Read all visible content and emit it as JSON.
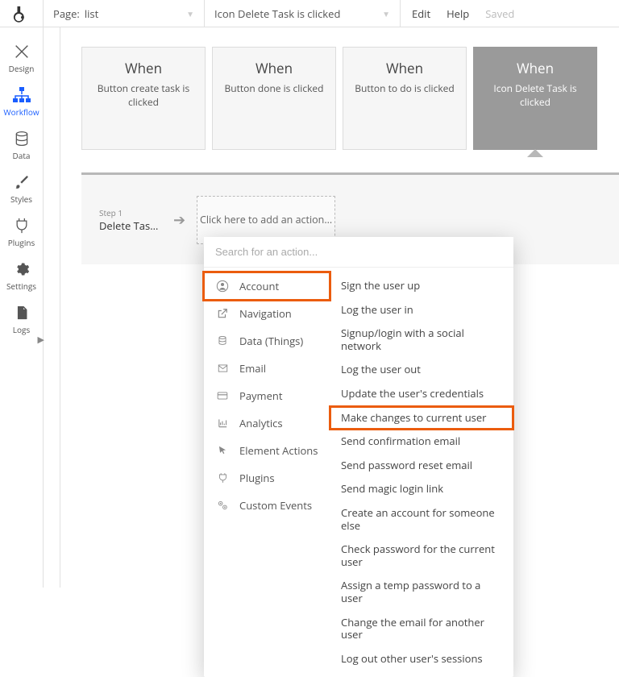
{
  "topbar": {
    "page_label": "Page:",
    "page_value": "list",
    "workflow_value": "Icon Delete Task is clicked",
    "menu_edit": "Edit",
    "menu_help": "Help",
    "menu_saved": "Saved"
  },
  "rail": {
    "design": "Design",
    "workflow": "Workflow",
    "data": "Data",
    "styles": "Styles",
    "plugins": "Plugins",
    "settings": "Settings",
    "logs": "Logs"
  },
  "events": [
    {
      "when": "When",
      "desc": "Button create task is clicked",
      "selected": false
    },
    {
      "when": "When",
      "desc": "Button done is clicked",
      "selected": false
    },
    {
      "when": "When",
      "desc": "Button to do is clicked",
      "selected": false
    },
    {
      "when": "When",
      "desc": "Icon Delete Task is clicked",
      "selected": true
    }
  ],
  "step": {
    "num": "Step 1",
    "label": "Delete Task...",
    "add_action": "Click here to add an action..."
  },
  "dropdown": {
    "search_placeholder": "Search for an action...",
    "categories": [
      {
        "label": "Account",
        "icon": "user-circle",
        "highlighted": true
      },
      {
        "label": "Navigation",
        "icon": "external",
        "highlighted": false
      },
      {
        "label": "Data (Things)",
        "icon": "database",
        "highlighted": false
      },
      {
        "label": "Email",
        "icon": "envelope",
        "highlighted": false
      },
      {
        "label": "Payment",
        "icon": "card",
        "highlighted": false
      },
      {
        "label": "Analytics",
        "icon": "chart",
        "highlighted": false
      },
      {
        "label": "Element Actions",
        "icon": "cursor",
        "highlighted": false
      },
      {
        "label": "Plugins",
        "icon": "plug",
        "highlighted": false
      },
      {
        "label": "Custom Events",
        "icon": "gears",
        "highlighted": false
      }
    ],
    "actions": [
      {
        "label": "Sign the user up",
        "highlighted": false
      },
      {
        "label": "Log the user in",
        "highlighted": false
      },
      {
        "label": "Signup/login with a social network",
        "highlighted": false
      },
      {
        "label": "Log the user out",
        "highlighted": false
      },
      {
        "label": "Update the user's credentials",
        "highlighted": false
      },
      {
        "label": "Make changes to current user",
        "highlighted": true
      },
      {
        "label": "Send confirmation email",
        "highlighted": false
      },
      {
        "label": "Send password reset email",
        "highlighted": false
      },
      {
        "label": "Send magic login link",
        "highlighted": false
      },
      {
        "label": "Create an account for someone else",
        "highlighted": false
      },
      {
        "label": "Check password for the current user",
        "highlighted": false
      },
      {
        "label": "Assign a temp password to a user",
        "highlighted": false
      },
      {
        "label": "Change the email for another user",
        "highlighted": false
      },
      {
        "label": "Log out other user's sessions",
        "highlighted": false
      }
    ]
  }
}
